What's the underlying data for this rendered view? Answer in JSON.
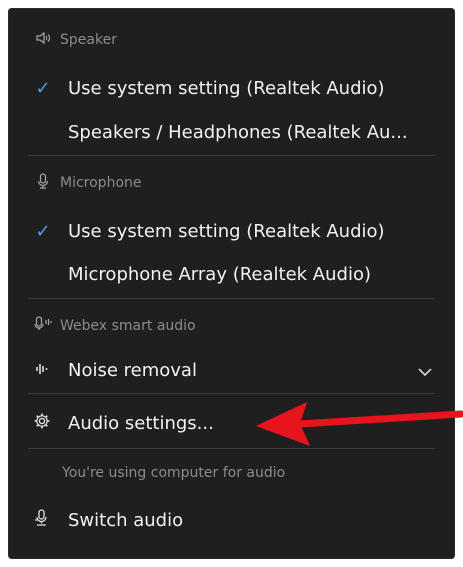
{
  "speaker": {
    "header": "Speaker",
    "header_icon": "speaker-icon",
    "items": [
      {
        "label": "Use system setting (Realtek Audio)",
        "checked": true
      },
      {
        "label": "Speakers / Headphones (Realtek Au...",
        "checked": false
      }
    ]
  },
  "microphone": {
    "header": "Microphone",
    "header_icon": "microphone-icon",
    "items": [
      {
        "label": "Use system setting (Realtek Audio)",
        "checked": true
      },
      {
        "label": "Microphone Array (Realtek Audio)",
        "checked": false
      }
    ]
  },
  "smart_audio": {
    "header": "Webex smart audio",
    "header_icon": "smart-audio-icon",
    "noise_removal": {
      "label": "Noise removal",
      "icon": "noise-removal-icon"
    }
  },
  "audio_settings": {
    "label": "Audio settings...",
    "icon": "gear-icon"
  },
  "footer": {
    "note": "You're using computer for audio",
    "switch_audio": {
      "label": "Switch audio",
      "icon": "switch-audio-icon"
    }
  },
  "colors": {
    "menu_background": "#1f1f1f",
    "check": "#4f9df6",
    "annotation_arrow": "#e8141c"
  }
}
